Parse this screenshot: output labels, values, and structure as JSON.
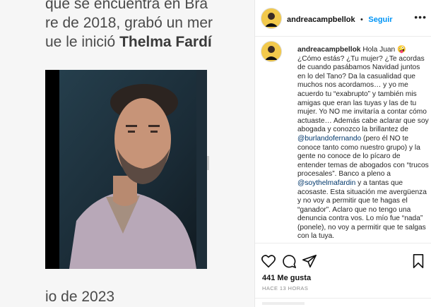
{
  "article": {
    "line1": "que se encuentra en Bra",
    "line2": "re de 2018, grabó un mer",
    "line3_prefix": "ue le inició ",
    "line3_bold": "Thelma Fardí",
    "line4": "io de 2023"
  },
  "post": {
    "username": "andreacampbellok",
    "separator": "•",
    "follow_label": "Seguir",
    "more_label": "•••",
    "caption_username": "andreacampbellok",
    "caption_part1": "Hola Juan 🤪¿Cómo estás? ¿Tu mujer? ¿Te acordas de cuando pasábamos Navidad juntos en lo del Tano? Da la casualidad que muchos nos acordamos… y yo me acuerdo tu “exabrupto” y también mis amigas que eran las tuyas y las de tu mujer. Yo NO me invitaría a contar cómo actuaste… Además cabe aclarar que soy abogada y conozco la brillantez de ",
    "mention1": "@burlandofernando",
    "caption_part2": " (pero él NO te conoce tanto como nuestro grupo) y la gente no conoce de lo pícaro de entender temas de abogados con “trucos procesales”. Banco a pleno a ",
    "mention2": "@soythelmafardin",
    "caption_part3": " y a tantas que acosaste. Esta situación me avergüenza y no voy a permitir que te hagas el “ganador”. Aclaro que no tengo una denuncia contra vos. Lo mío fue “nada” (ponele), no voy a permitir que te salgas con la tuya.",
    "likes": "441 Me gusta",
    "time": "HACE 13 HORAS"
  },
  "colors": {
    "follow": "#0095f6",
    "mention": "#00376b",
    "avatar": "#f2c94c"
  },
  "icons": [
    "heart-icon",
    "comment-icon",
    "share-icon",
    "bookmark-icon",
    "more-icon"
  ]
}
